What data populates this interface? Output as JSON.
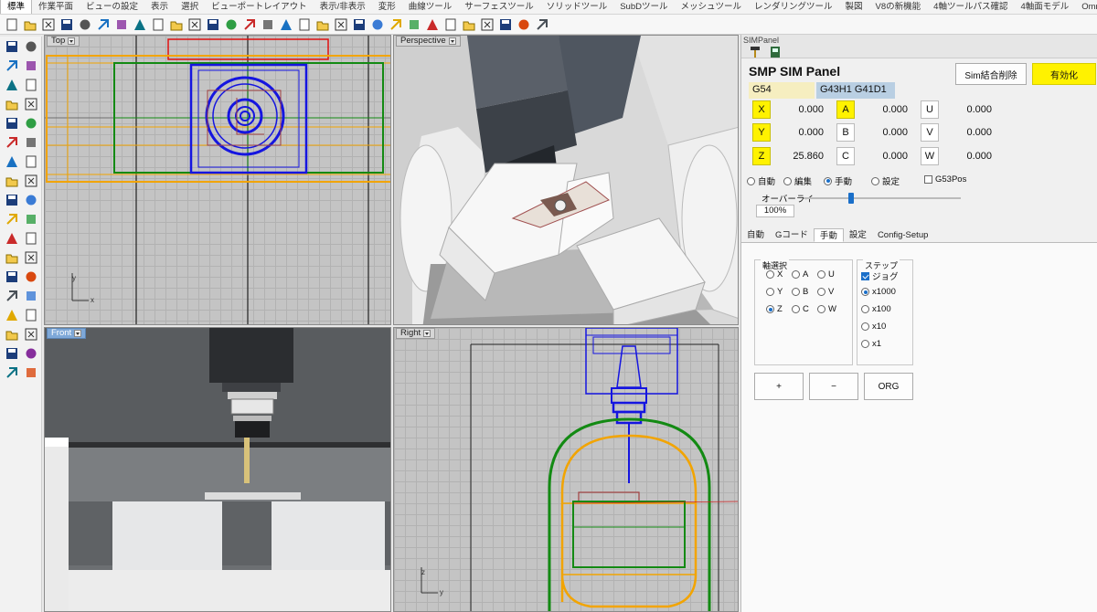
{
  "menu_tabs": [
    "標準",
    "作業平面",
    "ビューの設定",
    "表示",
    "選択",
    "ビューポートレイアウト",
    "表示/非表示",
    "変形",
    "曲線ツール",
    "サーフェスツール",
    "ソリッドツール",
    "SubDツール",
    "メッシュツール",
    "レンダリングツール",
    "製図",
    "V8の新機能",
    "4軸ツールパス確認",
    "4軸面モデル",
    "Omni"
  ],
  "toolbar_icons": [
    "new-file-icon",
    "open-file-icon",
    "maximize-icon",
    "save-icon",
    "print-icon",
    "import-icon",
    "cut-icon",
    "copy-icon",
    "paste-icon",
    "undo-icon",
    "pan-hand-icon",
    "rotate-view-icon",
    "zoom-icon",
    "zoom-window-icon",
    "zoom-extents-icon",
    "zoom-selected-icon",
    "four-viewports-icon",
    "car-icon",
    "grid-snap-icon",
    "light-bulb-icon",
    "lock-icon",
    "layer-icon",
    "color-wheel-icon",
    "material-ball-icon",
    "render-sphere-icon",
    "render-blue-icon",
    "pen-icon",
    "flag-icon",
    "gear-icon",
    "help-icon"
  ],
  "viewports": {
    "top": {
      "title": "Top"
    },
    "perspective": {
      "title": "Perspective"
    },
    "front": {
      "title": "Front"
    },
    "right": {
      "title": "Right"
    }
  },
  "sim_panel": {
    "window_title": "SIMPanel",
    "title": "SMP SIM Panel",
    "clear_button": "Sim結合削除",
    "enable_button": "有効化",
    "enable_color": "#fff200",
    "work_offset": "G54",
    "tool_offset": "G43H1 G41D1",
    "axes": [
      {
        "label": "X",
        "value": "0.000",
        "highlight": true
      },
      {
        "label": "Y",
        "value": "0.000",
        "highlight": true
      },
      {
        "label": "Z",
        "value": "25.860",
        "highlight": true
      },
      {
        "label": "A",
        "value": "0.000",
        "highlight": true
      },
      {
        "label": "B",
        "value": "0.000",
        "highlight": false
      },
      {
        "label": "C",
        "value": "0.000",
        "highlight": false
      },
      {
        "label": "U",
        "value": "0.000",
        "highlight": false
      },
      {
        "label": "V",
        "value": "0.000",
        "highlight": false
      },
      {
        "label": "W",
        "value": "0.000",
        "highlight": false
      }
    ],
    "modes": [
      {
        "label": "自動",
        "selected": false
      },
      {
        "label": "編集",
        "selected": false
      },
      {
        "label": "手動",
        "selected": true
      },
      {
        "label": "設定",
        "selected": false
      }
    ],
    "g53pos_label": "G53Pos",
    "override_label": "オーバーライ",
    "override_value": "100%",
    "override_level": 1.0,
    "tabs": [
      "自動",
      "Gコード",
      "手動",
      "設定",
      "Config-Setup"
    ],
    "active_tab": "手動",
    "axis_select_title": "軸選択",
    "axis_options": [
      {
        "label": "X",
        "selected": false
      },
      {
        "label": "A",
        "selected": false
      },
      {
        "label": "U",
        "selected": false
      },
      {
        "label": "Y",
        "selected": false
      },
      {
        "label": "B",
        "selected": false
      },
      {
        "label": "V",
        "selected": false
      },
      {
        "label": "Z",
        "selected": true
      },
      {
        "label": "C",
        "selected": false
      },
      {
        "label": "W",
        "selected": false
      }
    ],
    "step_title": "ステップ",
    "jog_label": "ジョグ",
    "step_options": [
      {
        "label": "x1000",
        "selected": true
      },
      {
        "label": "x100",
        "selected": false
      },
      {
        "label": "x10",
        "selected": false
      },
      {
        "label": "x1",
        "selected": false
      }
    ],
    "plus_button": "+",
    "minus_button": "−",
    "org_button": "ORG"
  }
}
